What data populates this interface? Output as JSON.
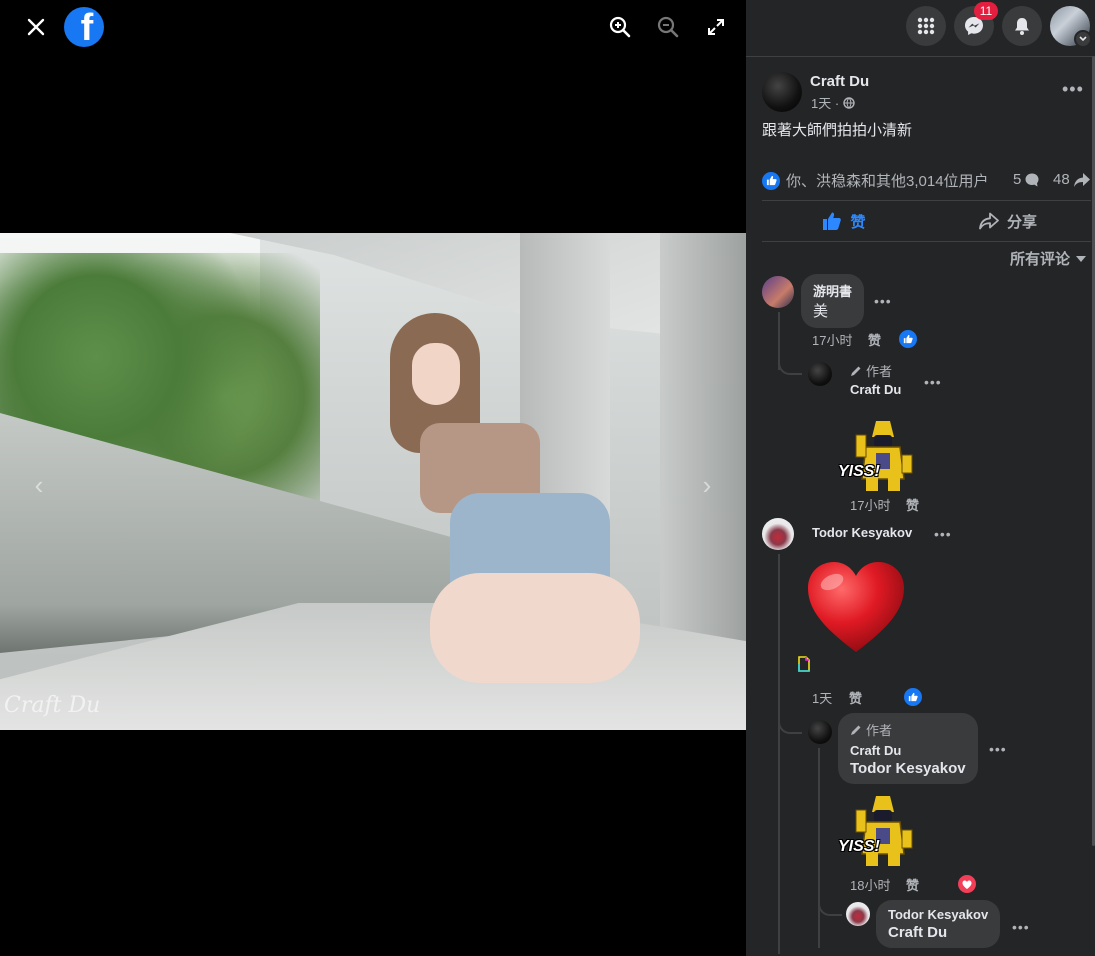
{
  "viewer": {
    "watermark": "Craft Du",
    "close_icon": "close-icon",
    "logo_icon": "facebook-logo-icon",
    "zoom_in_icon": "zoom-in-icon",
    "zoom_out_icon": "zoom-out-icon",
    "fullscreen_icon": "fullscreen-icon"
  },
  "topbar": {
    "menu_icon": "grid-menu-icon",
    "messenger_icon": "messenger-icon",
    "messenger_badge": "11",
    "notifications_icon": "bell-icon"
  },
  "post": {
    "author": "Craft Du",
    "time": "1天 ·",
    "caption": "跟著大師們拍拍小清新",
    "reactions_text": "你、洪稳森和其他3,014位用户",
    "comment_count": "5",
    "share_count": "48",
    "like_label": "赞",
    "share_label": "分享",
    "sort_label": "所有评论"
  },
  "comments": [
    {
      "author": "游明書",
      "text": "美",
      "time": "17小时",
      "like_label": "赞",
      "reply": {
        "badge": "作者",
        "author": "Craft Du",
        "sticker": "YISS!",
        "time": "17小时",
        "like_label": "赞"
      }
    },
    {
      "author": "Todor Kesyakov",
      "time": "1天",
      "like_label": "赞",
      "reply": {
        "badge": "作者",
        "author": "Craft Du",
        "text": "Todor Kesyakov",
        "sticker": "YISS!",
        "time": "18小时",
        "like_label": "赞",
        "reply": {
          "author": "Todor Kesyakov",
          "text": "Craft Du"
        }
      }
    }
  ],
  "colors": {
    "panel_bg": "#242526",
    "accent": "#1877f2",
    "text": "#e4e6eb",
    "muted": "#b0b3b8",
    "love": "#f33e58"
  }
}
